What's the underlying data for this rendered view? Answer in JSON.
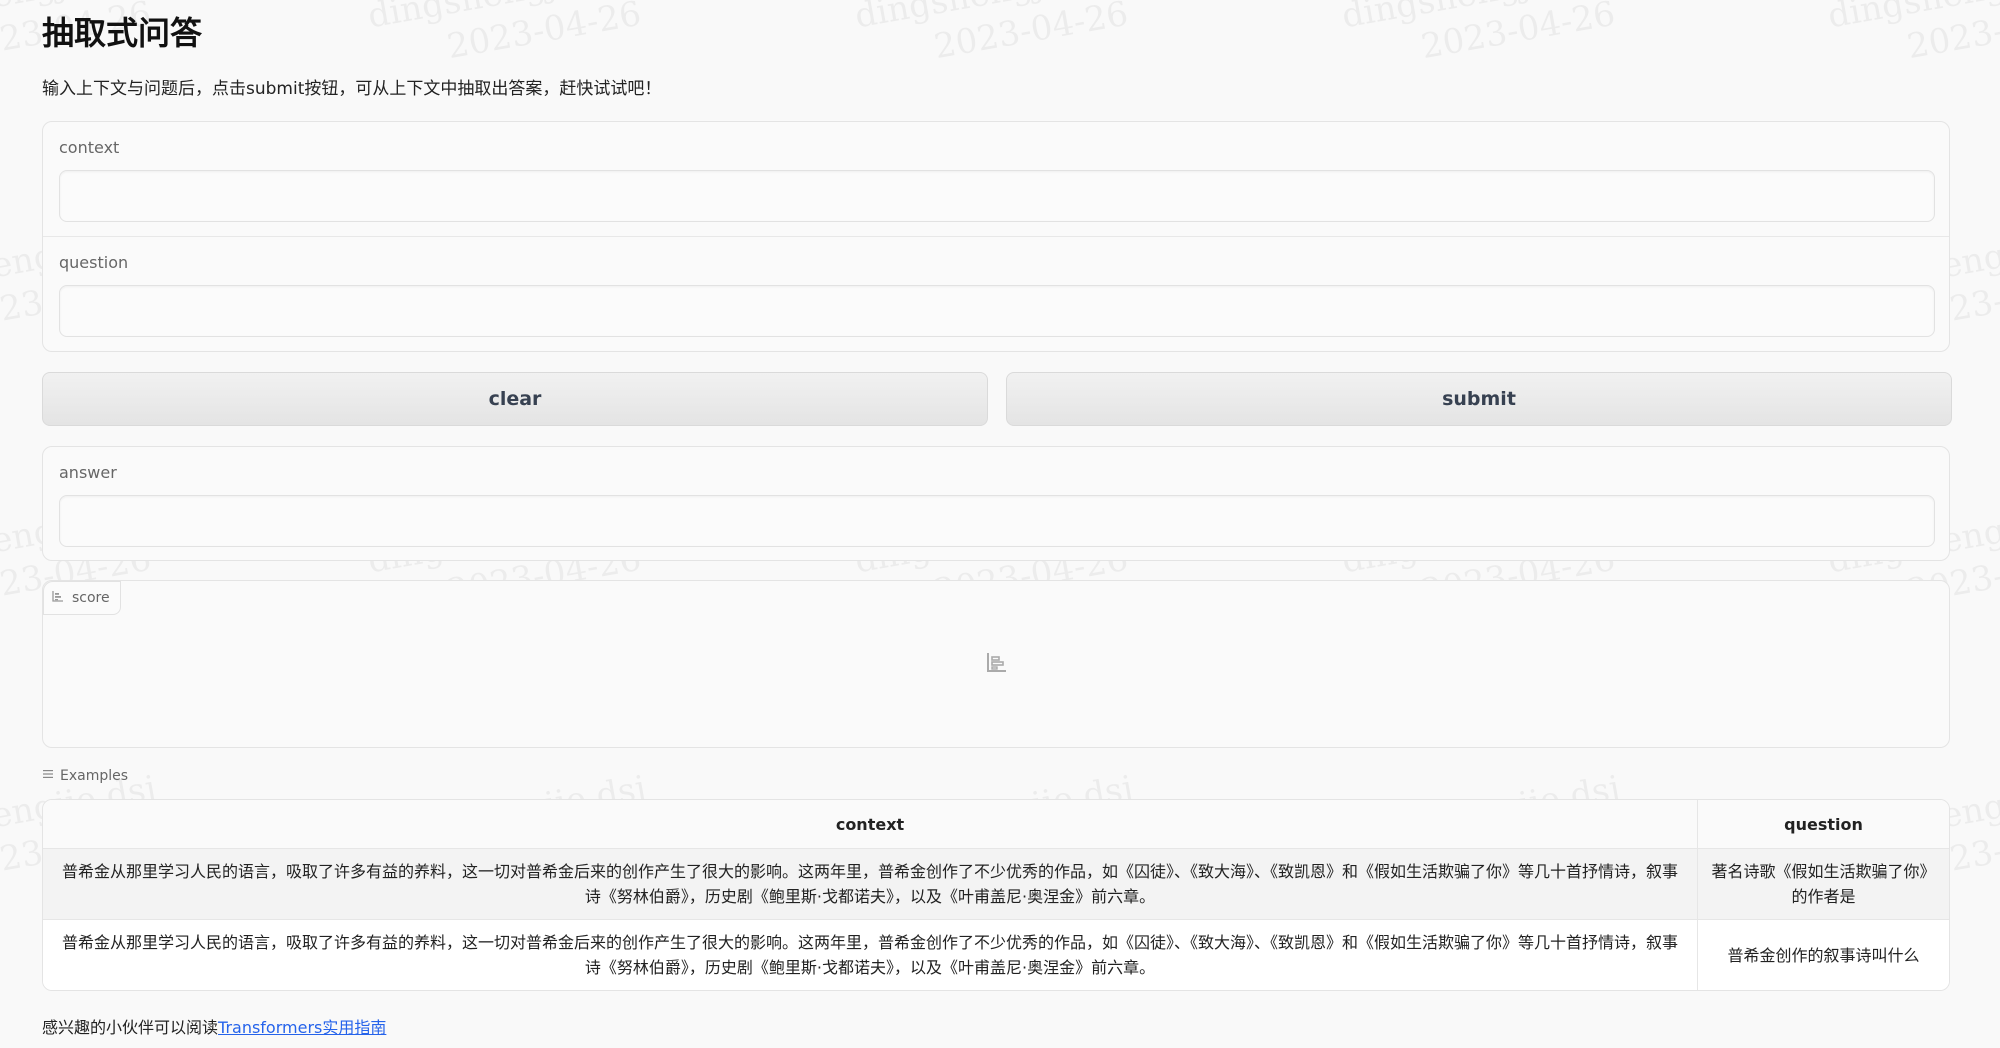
{
  "page": {
    "title": "抽取式问答",
    "subtitle": "输入上下文与问题后，点击submit按钮，可从上下文中抽取出答案，赶快试试吧！"
  },
  "inputs": {
    "context_label": "context",
    "context_value": "",
    "question_label": "question",
    "question_value": ""
  },
  "buttons": {
    "clear_label": "clear",
    "submit_label": "submit"
  },
  "outputs": {
    "answer_label": "answer",
    "answer_value": "",
    "score_label": "score"
  },
  "examples": {
    "label": "Examples",
    "columns": [
      "context",
      "question"
    ],
    "rows": [
      {
        "context": "普希金从那里学习人民的语言，吸取了许多有益的养料，这一切对普希金后来的创作产生了很大的影响。这两年里，普希金创作了不少优秀的作品，如《囚徒》、《致大海》、《致凯恩》和《假如生活欺骗了你》等几十首抒情诗，叙事诗《努林伯爵》，历史剧《鲍里斯·戈都诺夫》，以及《叶甫盖尼·奥涅金》前六章。",
        "question": "著名诗歌《假如生活欺骗了你》的作者是"
      },
      {
        "context": "普希金从那里学习人民的语言，吸取了许多有益的养料，这一切对普希金后来的创作产生了很大的影响。这两年里，普希金创作了不少优秀的作品，如《囚徒》、《致大海》、《致凯恩》和《假如生活欺骗了你》等几十首抒情诗，叙事诗《努林伯爵》，历史剧《鲍里斯·戈都诺夫》，以及《叶甫盖尼·奥涅金》前六章。",
        "question": "普希金创作的叙事诗叫什么"
      }
    ]
  },
  "footer": {
    "prefix": "感兴趣的小伙伴可以阅读",
    "link_text": "Transformers实用指南"
  },
  "watermark": {
    "line1": "dingshengjie.dsj",
    "line2": "2023-04-26"
  },
  "icons": {
    "score_tag_icon": "bar-chart-icon",
    "score_placeholder_icon": "bar-chart-icon",
    "examples_icon": "list-icon"
  }
}
